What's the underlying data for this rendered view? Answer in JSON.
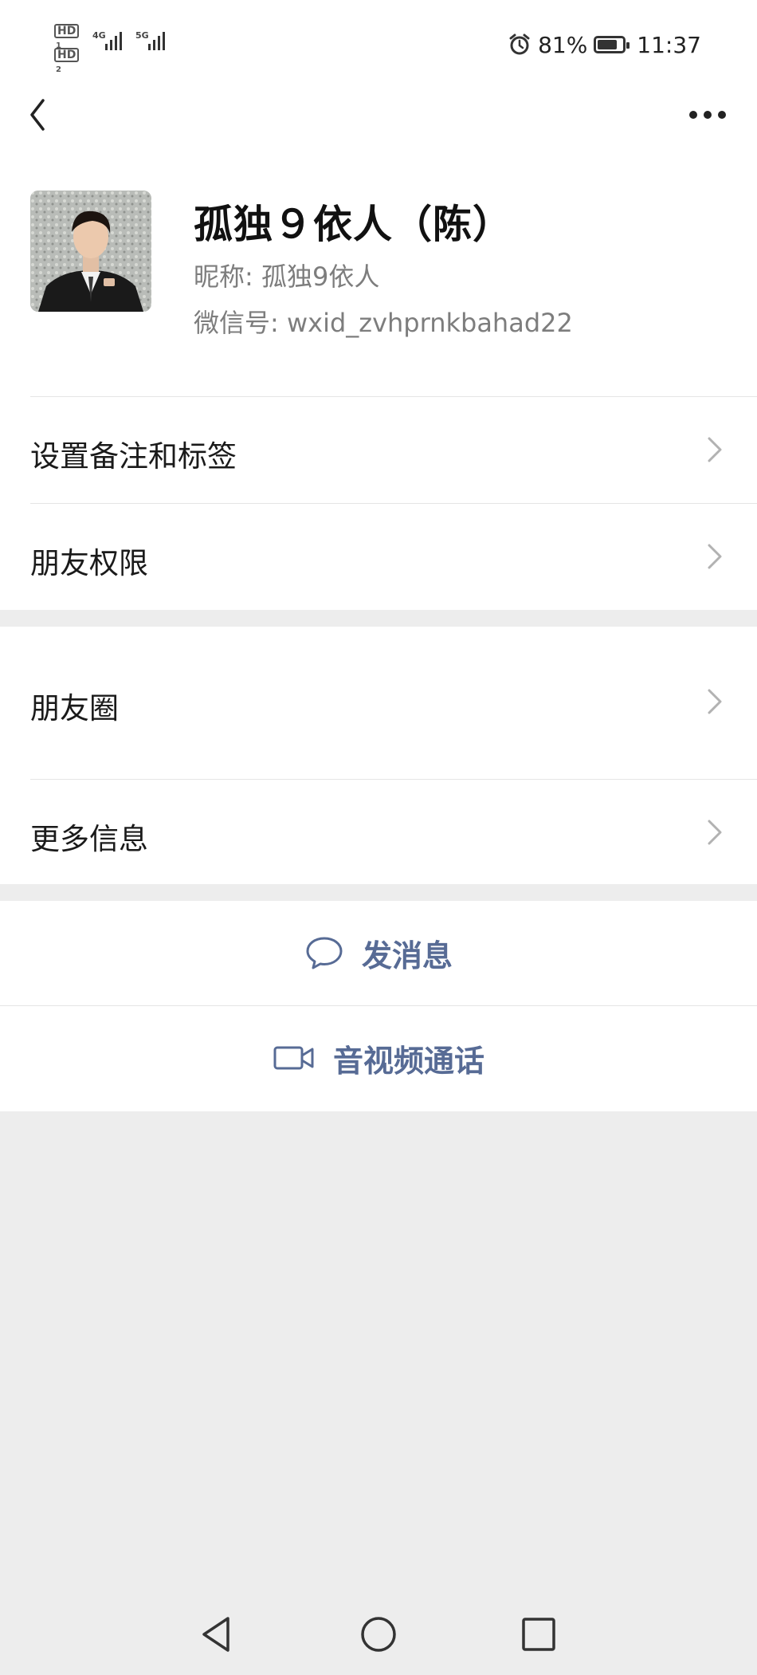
{
  "status_bar": {
    "hd1": "HD",
    "hd1_sub": "1",
    "hd2": "HD",
    "hd2_sub": "2",
    "net1": "4G",
    "net2": "5G",
    "battery_percent": "81%",
    "battery_level": 0.81,
    "time": "11:37"
  },
  "profile": {
    "name": "孤独９依人（陈）",
    "nickname": "昵称: 孤独9依人",
    "wechat_id": "微信号: wxid_zvhprnkbahad22"
  },
  "menu": {
    "remark_tags": "设置备注和标签",
    "friend_permissions": "朋友权限",
    "moments": "朋友圈",
    "more_info": "更多信息"
  },
  "actions": {
    "send_message": "发消息",
    "video_call": "音视频通话"
  },
  "colors": {
    "link_blue": "#576b95",
    "background": "#ededed"
  }
}
